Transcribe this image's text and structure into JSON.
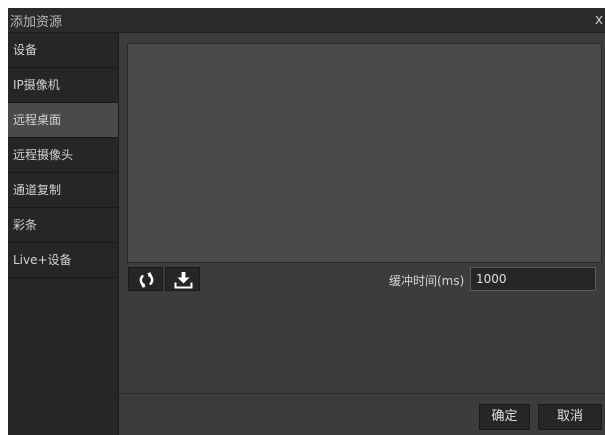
{
  "window": {
    "title": "添加资源",
    "close_glyph": "x"
  },
  "sidebar": {
    "items": [
      {
        "label": "设备",
        "active": false
      },
      {
        "label": "IP摄像机",
        "active": false
      },
      {
        "label": "远程桌面",
        "active": true
      },
      {
        "label": "远程摄像头",
        "active": false
      },
      {
        "label": "通道复制",
        "active": false
      },
      {
        "label": "彩条",
        "active": false
      },
      {
        "label": "Live+设备",
        "active": false
      }
    ]
  },
  "toolbar": {
    "refresh_icon": "refresh-icon",
    "download_icon": "download-icon"
  },
  "buffer": {
    "label": "缓冲时间(ms)",
    "value": "1000"
  },
  "footer": {
    "ok_label": "确定",
    "cancel_label": "取消"
  },
  "colors": {
    "dialog_bg": "#3c3c3c",
    "sidebar_bg": "#262626",
    "active_item_bg": "#4a4a4a",
    "preview_bg": "#4a4a4a"
  }
}
